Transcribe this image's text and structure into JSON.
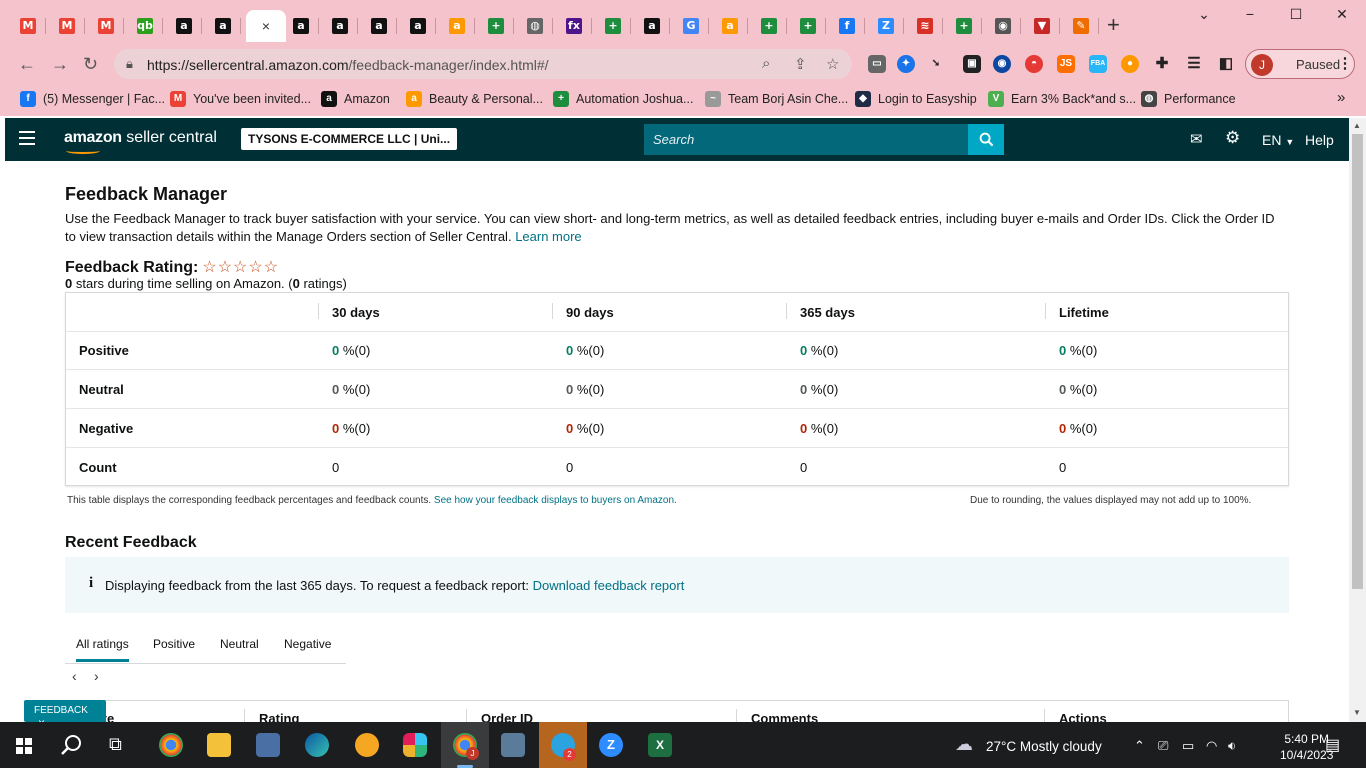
{
  "browser": {
    "active_tab_close": "×",
    "new_tab": "+",
    "window_controls": {
      "minimize": "−",
      "maximize": "☐",
      "close": "✕",
      "tabsearch": "⌄"
    },
    "url_host": "https://sellercentral.amazon.com",
    "url_path": "/feedback-manager/index.html#/",
    "profile_initial": "J",
    "profile_label": "Paused",
    "tab_favicons": [
      {
        "icon": "gmail-icon",
        "glyph": "M",
        "color": "#ea4335"
      },
      {
        "icon": "gmail-icon",
        "glyph": "M",
        "color": "#ea4335"
      },
      {
        "icon": "gmail-icon",
        "glyph": "M",
        "color": "#ea4335"
      },
      {
        "icon": "qb-icon",
        "glyph": "qb",
        "color": "#2ca01c"
      },
      {
        "icon": "amazon-icon",
        "glyph": "a",
        "color": "#111"
      },
      {
        "icon": "amazon-icon",
        "glyph": "a",
        "color": "#111"
      },
      {
        "icon": "amazon-icon",
        "glyph": "a",
        "color": "#111"
      },
      {
        "icon": "amazon-icon",
        "glyph": "a",
        "color": "#111"
      },
      {
        "icon": "amazon-icon",
        "glyph": "a",
        "color": "#111"
      },
      {
        "icon": "amazon-icon",
        "glyph": "a",
        "color": "#111"
      },
      {
        "icon": "amazon-smile-icon",
        "glyph": "a",
        "color": "#ff9900"
      },
      {
        "icon": "sheets-plus-icon",
        "glyph": "+",
        "color": "#1e8e3e"
      },
      {
        "icon": "globe-icon",
        "glyph": "◍",
        "color": "#666"
      },
      {
        "icon": "fedex-icon",
        "glyph": "fx",
        "color": "#4d148c"
      },
      {
        "icon": "sheets-plus-icon",
        "glyph": "+",
        "color": "#1e8e3e"
      },
      {
        "icon": "amazon-icon",
        "glyph": "a",
        "color": "#111"
      },
      {
        "icon": "google-icon",
        "glyph": "G",
        "color": "#4285f4"
      },
      {
        "icon": "amazon-smile-icon",
        "glyph": "a",
        "color": "#ff9900"
      },
      {
        "icon": "sheets-plus-icon",
        "glyph": "+",
        "color": "#1e8e3e"
      },
      {
        "icon": "sheets-plus-icon",
        "glyph": "+",
        "color": "#1e8e3e"
      },
      {
        "icon": "facebook-icon",
        "glyph": "f",
        "color": "#1877f2"
      },
      {
        "icon": "zoom-icon",
        "glyph": "Z",
        "color": "#2d8cff"
      },
      {
        "icon": "chart-icon",
        "glyph": "≋",
        "color": "#d93025"
      },
      {
        "icon": "sheets-plus-icon",
        "glyph": "+",
        "color": "#1e8e3e"
      },
      {
        "icon": "chrome-icon",
        "glyph": "◉",
        "color": "#555"
      },
      {
        "icon": "vivaldi-icon",
        "glyph": "▼",
        "color": "#c62828"
      },
      {
        "icon": "pen-icon",
        "glyph": "✎",
        "color": "#ef6c00"
      }
    ],
    "bookmarks": [
      {
        "label": "(5) Messenger | Fac...",
        "icon": "facebook-icon",
        "glyph": "f",
        "color": "#1877f2"
      },
      {
        "label": "You've been invited...",
        "icon": "gmail-icon",
        "glyph": "M",
        "color": "#ea4335"
      },
      {
        "label": "Amazon",
        "icon": "amazon-icon",
        "glyph": "a",
        "color": "#111"
      },
      {
        "label": "Beauty & Personal...",
        "icon": "amazon-smile-icon",
        "glyph": "a",
        "color": "#ff9900"
      },
      {
        "label": "Automation Joshua...",
        "icon": "sheets-plus-icon",
        "glyph": "+",
        "color": "#1e8e3e"
      },
      {
        "label": "Team Borj Asin Che...",
        "icon": "signature-icon",
        "glyph": "~",
        "color": "#999"
      },
      {
        "label": "Login to Easyship",
        "icon": "easyship-icon",
        "glyph": "◆",
        "color": "#1f2a44"
      },
      {
        "label": "Earn 3% Back*and s...",
        "icon": "leaf-icon",
        "glyph": "V",
        "color": "#4caf50"
      },
      {
        "label": "Performance",
        "icon": "globe-icon",
        "glyph": "◍",
        "color": "#444"
      }
    ],
    "bookmarks_more": "»"
  },
  "sc_header": {
    "logo_a": "amazon",
    "logo_b": " seller central",
    "account": "TYSONS E-COMMERCE LLC | Uni...",
    "search_placeholder": "Search",
    "language": "EN",
    "help": "Help"
  },
  "page": {
    "title": "Feedback Manager",
    "description": "Use the Feedback Manager to track buyer satisfaction with your service. You can view short- and long-term metrics, as well as detailed feedback entries, including buyer e-mails and Order IDs. Click the Order ID to view transaction details within the Manage Orders section of Seller Central.",
    "learn_more": "Learn more",
    "rating_label": "Feedback Rating:",
    "stars": "☆☆☆☆☆",
    "rating_count_stars": "0",
    "rating_sub_mid": " stars during time selling on Amazon. (",
    "rating_count": "0",
    "rating_sub_end": " ratings)",
    "table": {
      "headers": [
        "30 days",
        "90 days",
        "365 days",
        "Lifetime"
      ],
      "rows": [
        {
          "label": "Positive",
          "values": [
            "0",
            "0",
            "0",
            "0"
          ],
          "counts": [
            " %(0)",
            " %(0)",
            " %(0)",
            " %(0)"
          ]
        },
        {
          "label": "Neutral",
          "values": [
            "0",
            "0",
            "0",
            "0"
          ],
          "counts": [
            " %(0)",
            " %(0)",
            " %(0)",
            " %(0)"
          ]
        },
        {
          "label": "Negative",
          "values": [
            "0",
            "0",
            "0",
            "0"
          ],
          "counts": [
            " %(0)",
            " %(0)",
            " %(0)",
            " %(0)"
          ]
        },
        {
          "label": "Count",
          "values": [
            "0",
            "0",
            "0",
            "0"
          ]
        }
      ]
    },
    "footnote_left": "This table displays the corresponding feedback percentages and feedback counts.",
    "footnote_link": "See how your feedback displays to buyers on Amazon.",
    "footnote_right": "Due to rounding, the values displayed may not add up to 100%.",
    "recent_title": "Recent Feedback",
    "info_icon": "i",
    "info_text": "Displaying feedback from the last 365 days. To request a feedback report:",
    "info_link": "Download feedback report",
    "tabs": [
      "All ratings",
      "Positive",
      "Neutral",
      "Negative"
    ],
    "pager_prev": "‹",
    "pager_next": "›",
    "list_headers": [
      "Date",
      "Rating",
      "Order ID",
      "Comments",
      "Actions"
    ],
    "feedback_badge": "FEEDBACK",
    "feedback_badge_close": "×"
  },
  "taskbar": {
    "weather": "27°C  Mostly cloudy",
    "time": "5:40 PM",
    "date": "10/4/2023",
    "chrome_badge": "J",
    "telegram_badge": "2"
  },
  "colors": {
    "sc_header": "#002f36",
    "search": "#03687a",
    "search_button": "#00a8c5",
    "positive": "#067d62",
    "negative": "#b12704",
    "link": "#007185",
    "chrome_frame": "#f5c3cc"
  }
}
